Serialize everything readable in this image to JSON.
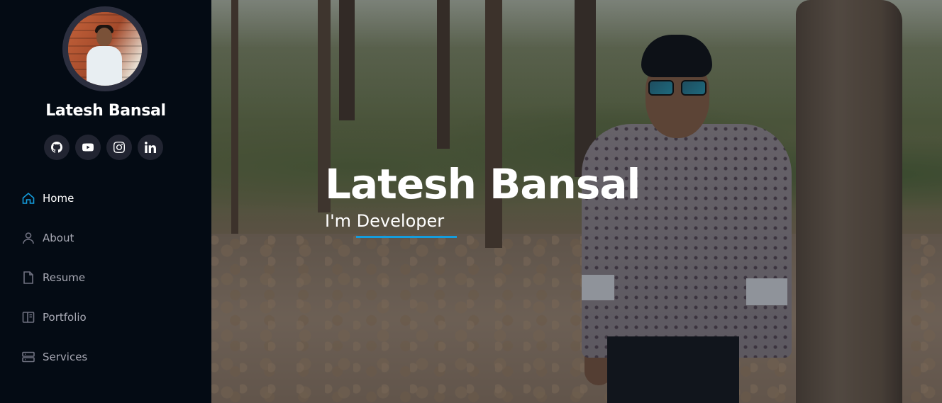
{
  "profile": {
    "name": "Latesh Bansal",
    "avatar_alt": "profile photo"
  },
  "social": [
    {
      "icon": "github-icon",
      "label": "GitHub"
    },
    {
      "icon": "youtube-icon",
      "label": "YouTube"
    },
    {
      "icon": "instagram-icon",
      "label": "Instagram"
    },
    {
      "icon": "linkedin-icon",
      "label": "LinkedIn"
    }
  ],
  "nav": {
    "items": [
      {
        "label": "Home",
        "icon": "home-icon",
        "active": true
      },
      {
        "label": "About",
        "icon": "person-icon",
        "active": false
      },
      {
        "label": "Resume",
        "icon": "file-icon",
        "active": false
      },
      {
        "label": "Portfolio",
        "icon": "book-icon",
        "active": false
      },
      {
        "label": "Services",
        "icon": "server-icon",
        "active": false
      }
    ],
    "next_partial": "Services"
  },
  "hero": {
    "title": "Latesh Bansal",
    "subtitle": "I'm Developer"
  },
  "colors": {
    "accent": "#149ddd",
    "sidebar_bg": "#040b14",
    "social_btn_bg": "#212431"
  }
}
